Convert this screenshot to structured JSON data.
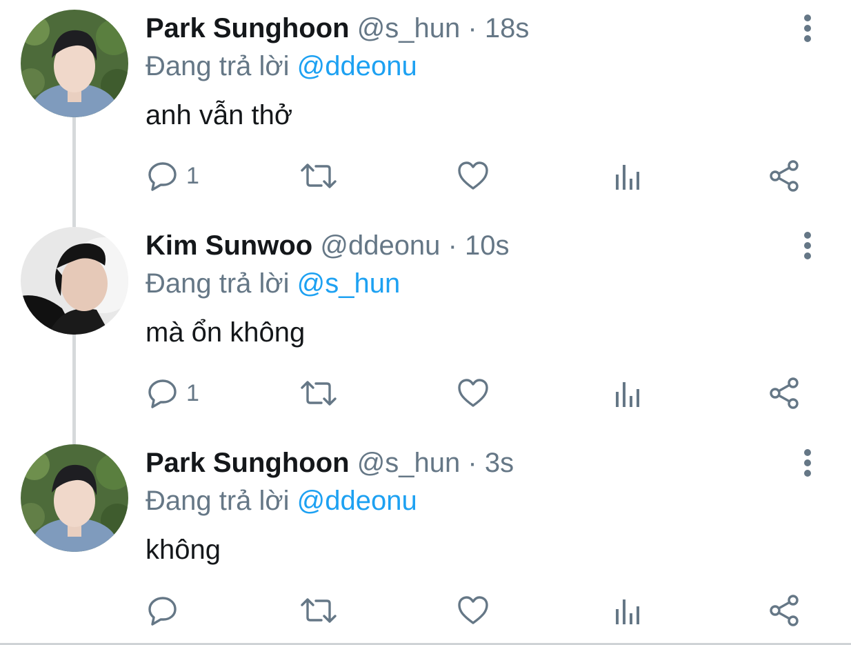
{
  "tweets": [
    {
      "name": "Park Sunghoon",
      "handle": "@s_hun",
      "separator": "·",
      "time": "18s",
      "reply_prefix": "Đang trả lời",
      "reply_to": "@ddeonu",
      "text": "anh vẫn thở",
      "reply_count": "1",
      "avatar_icon": "avatar-photo"
    },
    {
      "name": "Kim Sunwoo",
      "handle": "@ddeonu",
      "separator": "·",
      "time": "10s",
      "reply_prefix": "Đang trả lời",
      "reply_to": "@s_hun",
      "text": "mà ổn không",
      "reply_count": "1",
      "avatar_icon": "avatar-photo"
    },
    {
      "name": "Park Sunghoon",
      "handle": "@s_hun",
      "separator": "·",
      "time": "3s",
      "reply_prefix": "Đang trả lời",
      "reply_to": "@ddeonu",
      "text": "không",
      "reply_count": "",
      "avatar_icon": "avatar-photo"
    }
  ],
  "colors": {
    "primary_text": "#14171a",
    "secondary_text": "#657786",
    "accent": "#1da1f2",
    "thread_line": "#d6d9db"
  },
  "icons": {
    "more": "more-vertical-icon",
    "reply": "reply-icon",
    "retweet": "retweet-icon",
    "like": "heart-icon",
    "stats": "analytics-icon",
    "share": "share-icon"
  }
}
